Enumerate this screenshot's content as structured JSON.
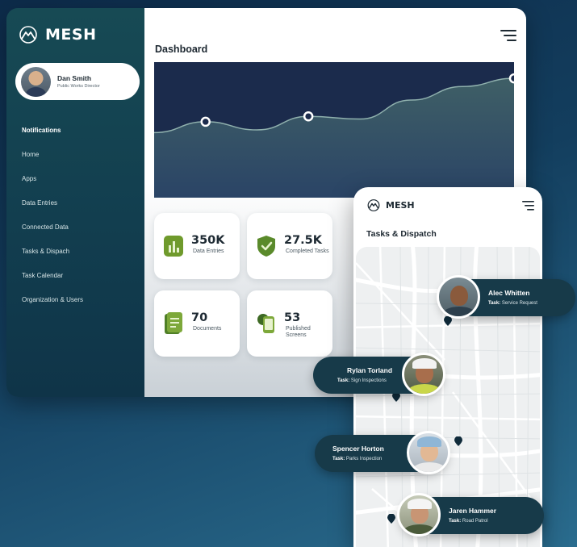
{
  "brand": {
    "name": "MESH"
  },
  "user": {
    "name": "Dan Smith",
    "role": "Public Works Director"
  },
  "sidebar": {
    "items": [
      {
        "label": "Notifications",
        "active": true
      },
      {
        "label": "Home"
      },
      {
        "label": "Apps"
      },
      {
        "label": "Data Entries"
      },
      {
        "label": "Connected Data"
      },
      {
        "label": "Tasks & Dispach"
      },
      {
        "label": "Task Calendar"
      },
      {
        "label": "Organization & Users"
      }
    ]
  },
  "dashboard": {
    "title": "Dashboard",
    "stats": [
      {
        "value": "350K",
        "label": "Data Entries",
        "icon": "bar-chart-icon"
      },
      {
        "value": "27.5K",
        "label": "Completed Tasks",
        "icon": "shield-check-icon"
      },
      {
        "value": "70",
        "label": "Documents",
        "icon": "document-icon"
      },
      {
        "value": "53",
        "label": "Published Screens",
        "icon": "screens-icon"
      }
    ]
  },
  "chart_data": {
    "type": "area",
    "series": [
      {
        "values": [
          0.48,
          0.56,
          0.5,
          0.6,
          0.58,
          0.72,
          0.82,
          0.88
        ]
      }
    ],
    "highlighted_points": [
      1,
      3,
      7
    ],
    "grid": false,
    "colors": {
      "background": "#1b2b4c",
      "fill": "#3f5f66",
      "line": "#8fb0ad"
    }
  },
  "mobile": {
    "brand": "MESH",
    "title": "Tasks & Dispatch",
    "people": [
      {
        "name": "Alec Whitten",
        "task_prefix": "Task:",
        "task": "Service Request"
      },
      {
        "name": "Rylan Torland",
        "task_prefix": "Task:",
        "task": "Sign Inspections"
      },
      {
        "name": "Spencer Horton",
        "task_prefix": "Task:",
        "task": "Parks Inspection"
      },
      {
        "name": "Jaren Hammer",
        "task_prefix": "Task:",
        "task": "Road Patrol"
      }
    ]
  },
  "colors": {
    "accent_green": "#5b8c2a",
    "sidebar": "#174a54",
    "card_dark": "#173a49"
  }
}
